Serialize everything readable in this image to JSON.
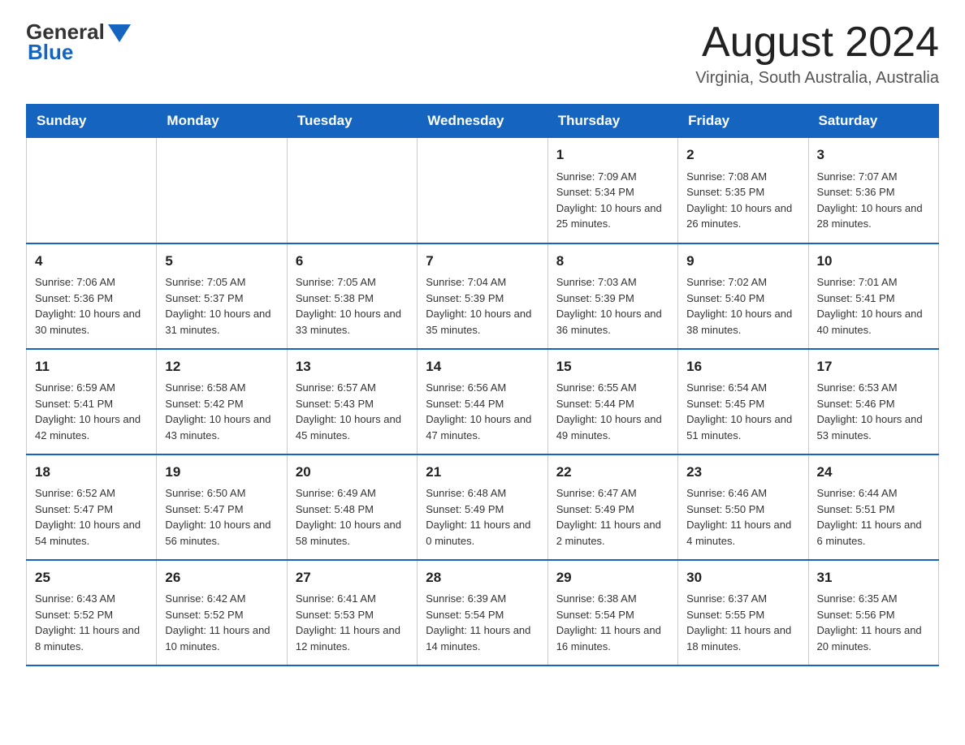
{
  "header": {
    "logo_general": "General",
    "logo_blue": "Blue",
    "title": "August 2024",
    "subtitle": "Virginia, South Australia, Australia"
  },
  "weekdays": [
    "Sunday",
    "Monday",
    "Tuesday",
    "Wednesday",
    "Thursday",
    "Friday",
    "Saturday"
  ],
  "weeks": [
    [
      {
        "day": "",
        "info": ""
      },
      {
        "day": "",
        "info": ""
      },
      {
        "day": "",
        "info": ""
      },
      {
        "day": "",
        "info": ""
      },
      {
        "day": "1",
        "info": "Sunrise: 7:09 AM\nSunset: 5:34 PM\nDaylight: 10 hours and 25 minutes."
      },
      {
        "day": "2",
        "info": "Sunrise: 7:08 AM\nSunset: 5:35 PM\nDaylight: 10 hours and 26 minutes."
      },
      {
        "day": "3",
        "info": "Sunrise: 7:07 AM\nSunset: 5:36 PM\nDaylight: 10 hours and 28 minutes."
      }
    ],
    [
      {
        "day": "4",
        "info": "Sunrise: 7:06 AM\nSunset: 5:36 PM\nDaylight: 10 hours and 30 minutes."
      },
      {
        "day": "5",
        "info": "Sunrise: 7:05 AM\nSunset: 5:37 PM\nDaylight: 10 hours and 31 minutes."
      },
      {
        "day": "6",
        "info": "Sunrise: 7:05 AM\nSunset: 5:38 PM\nDaylight: 10 hours and 33 minutes."
      },
      {
        "day": "7",
        "info": "Sunrise: 7:04 AM\nSunset: 5:39 PM\nDaylight: 10 hours and 35 minutes."
      },
      {
        "day": "8",
        "info": "Sunrise: 7:03 AM\nSunset: 5:39 PM\nDaylight: 10 hours and 36 minutes."
      },
      {
        "day": "9",
        "info": "Sunrise: 7:02 AM\nSunset: 5:40 PM\nDaylight: 10 hours and 38 minutes."
      },
      {
        "day": "10",
        "info": "Sunrise: 7:01 AM\nSunset: 5:41 PM\nDaylight: 10 hours and 40 minutes."
      }
    ],
    [
      {
        "day": "11",
        "info": "Sunrise: 6:59 AM\nSunset: 5:41 PM\nDaylight: 10 hours and 42 minutes."
      },
      {
        "day": "12",
        "info": "Sunrise: 6:58 AM\nSunset: 5:42 PM\nDaylight: 10 hours and 43 minutes."
      },
      {
        "day": "13",
        "info": "Sunrise: 6:57 AM\nSunset: 5:43 PM\nDaylight: 10 hours and 45 minutes."
      },
      {
        "day": "14",
        "info": "Sunrise: 6:56 AM\nSunset: 5:44 PM\nDaylight: 10 hours and 47 minutes."
      },
      {
        "day": "15",
        "info": "Sunrise: 6:55 AM\nSunset: 5:44 PM\nDaylight: 10 hours and 49 minutes."
      },
      {
        "day": "16",
        "info": "Sunrise: 6:54 AM\nSunset: 5:45 PM\nDaylight: 10 hours and 51 minutes."
      },
      {
        "day": "17",
        "info": "Sunrise: 6:53 AM\nSunset: 5:46 PM\nDaylight: 10 hours and 53 minutes."
      }
    ],
    [
      {
        "day": "18",
        "info": "Sunrise: 6:52 AM\nSunset: 5:47 PM\nDaylight: 10 hours and 54 minutes."
      },
      {
        "day": "19",
        "info": "Sunrise: 6:50 AM\nSunset: 5:47 PM\nDaylight: 10 hours and 56 minutes."
      },
      {
        "day": "20",
        "info": "Sunrise: 6:49 AM\nSunset: 5:48 PM\nDaylight: 10 hours and 58 minutes."
      },
      {
        "day": "21",
        "info": "Sunrise: 6:48 AM\nSunset: 5:49 PM\nDaylight: 11 hours and 0 minutes."
      },
      {
        "day": "22",
        "info": "Sunrise: 6:47 AM\nSunset: 5:49 PM\nDaylight: 11 hours and 2 minutes."
      },
      {
        "day": "23",
        "info": "Sunrise: 6:46 AM\nSunset: 5:50 PM\nDaylight: 11 hours and 4 minutes."
      },
      {
        "day": "24",
        "info": "Sunrise: 6:44 AM\nSunset: 5:51 PM\nDaylight: 11 hours and 6 minutes."
      }
    ],
    [
      {
        "day": "25",
        "info": "Sunrise: 6:43 AM\nSunset: 5:52 PM\nDaylight: 11 hours and 8 minutes."
      },
      {
        "day": "26",
        "info": "Sunrise: 6:42 AM\nSunset: 5:52 PM\nDaylight: 11 hours and 10 minutes."
      },
      {
        "day": "27",
        "info": "Sunrise: 6:41 AM\nSunset: 5:53 PM\nDaylight: 11 hours and 12 minutes."
      },
      {
        "day": "28",
        "info": "Sunrise: 6:39 AM\nSunset: 5:54 PM\nDaylight: 11 hours and 14 minutes."
      },
      {
        "day": "29",
        "info": "Sunrise: 6:38 AM\nSunset: 5:54 PM\nDaylight: 11 hours and 16 minutes."
      },
      {
        "day": "30",
        "info": "Sunrise: 6:37 AM\nSunset: 5:55 PM\nDaylight: 11 hours and 18 minutes."
      },
      {
        "day": "31",
        "info": "Sunrise: 6:35 AM\nSunset: 5:56 PM\nDaylight: 11 hours and 20 minutes."
      }
    ]
  ]
}
